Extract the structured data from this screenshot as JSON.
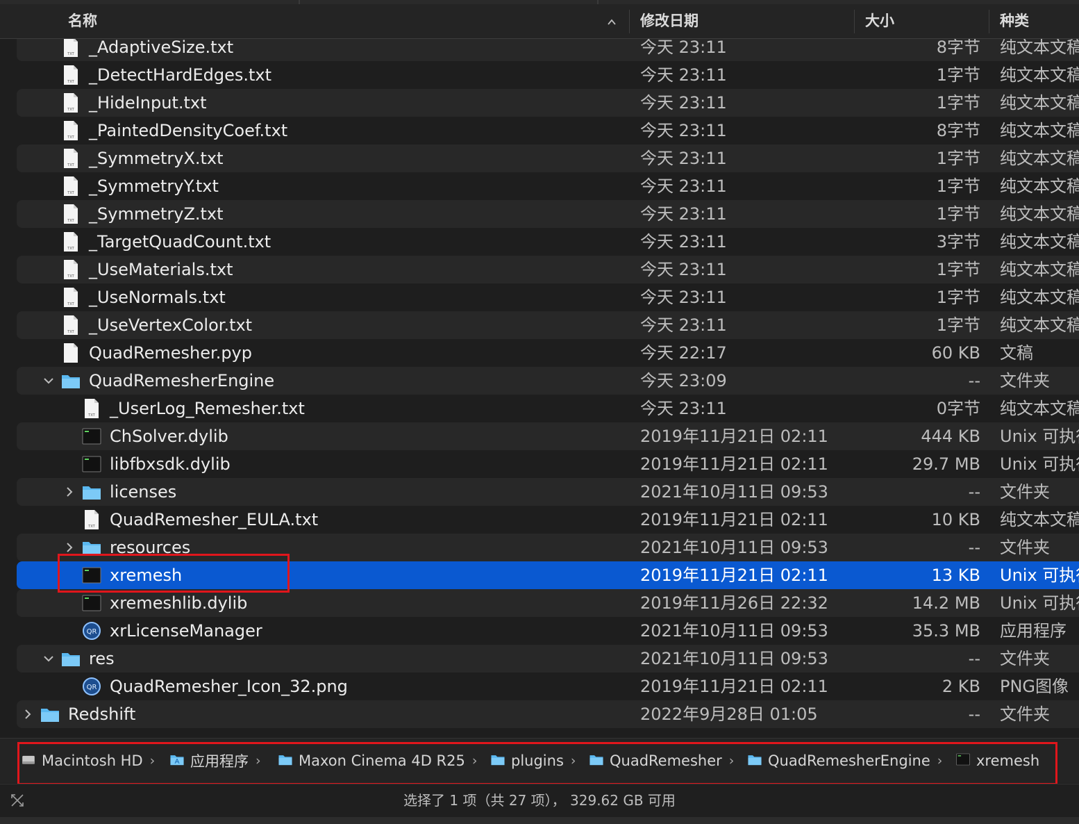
{
  "columns": {
    "name": "名称",
    "date": "修改日期",
    "size": "大小",
    "kind": "种类"
  },
  "rows": [
    {
      "name": "_AdaptiveSize.txt",
      "date": "今天 23:11",
      "size": "8字节",
      "kind": "纯文本文稿",
      "icon": "txt-file-icon",
      "depth": 2
    },
    {
      "name": "_DetectHardEdges.txt",
      "date": "今天 23:11",
      "size": "1字节",
      "kind": "纯文本文稿",
      "icon": "txt-file-icon",
      "depth": 2
    },
    {
      "name": "_HideInput.txt",
      "date": "今天 23:11",
      "size": "1字节",
      "kind": "纯文本文稿",
      "icon": "txt-file-icon",
      "depth": 2
    },
    {
      "name": "_PaintedDensityCoef.txt",
      "date": "今天 23:11",
      "size": "8字节",
      "kind": "纯文本文稿",
      "icon": "txt-file-icon",
      "depth": 2
    },
    {
      "name": "_SymmetryX.txt",
      "date": "今天 23:11",
      "size": "1字节",
      "kind": "纯文本文稿",
      "icon": "txt-file-icon",
      "depth": 2
    },
    {
      "name": "_SymmetryY.txt",
      "date": "今天 23:11",
      "size": "1字节",
      "kind": "纯文本文稿",
      "icon": "txt-file-icon",
      "depth": 2
    },
    {
      "name": "_SymmetryZ.txt",
      "date": "今天 23:11",
      "size": "1字节",
      "kind": "纯文本文稿",
      "icon": "txt-file-icon",
      "depth": 2
    },
    {
      "name": "_TargetQuadCount.txt",
      "date": "今天 23:11",
      "size": "3字节",
      "kind": "纯文本文稿",
      "icon": "txt-file-icon",
      "depth": 2
    },
    {
      "name": "_UseMaterials.txt",
      "date": "今天 23:11",
      "size": "1字节",
      "kind": "纯文本文稿",
      "icon": "txt-file-icon",
      "depth": 2
    },
    {
      "name": "_UseNormals.txt",
      "date": "今天 23:11",
      "size": "1字节",
      "kind": "纯文本文稿",
      "icon": "txt-file-icon",
      "depth": 2
    },
    {
      "name": "_UseVertexColor.txt",
      "date": "今天 23:11",
      "size": "1字节",
      "kind": "纯文本文稿",
      "icon": "txt-file-icon",
      "depth": 2
    },
    {
      "name": "QuadRemesher.pyp",
      "date": "今天 22:17",
      "size": "60 KB",
      "kind": "文稿",
      "icon": "document-icon",
      "depth": 2
    },
    {
      "name": "QuadRemesherEngine",
      "date": "今天 23:09",
      "size": "--",
      "kind": "文件夹",
      "icon": "folder-icon",
      "depth": 2,
      "disclosure": "open"
    },
    {
      "name": "_UserLog_Remesher.txt",
      "date": "今天 23:11",
      "size": "0字节",
      "kind": "纯文本文稿",
      "icon": "txt-file-icon",
      "depth": 3
    },
    {
      "name": "ChSolver.dylib",
      "date": "2019年11月21日 02:11",
      "size": "444 KB",
      "kind": "Unix 可执行文件",
      "icon": "terminal-exec-icon",
      "depth": 3
    },
    {
      "name": "libfbxsdk.dylib",
      "date": "2019年11月21日 02:11",
      "size": "29.7 MB",
      "kind": "Unix 可执行文件",
      "icon": "terminal-exec-icon",
      "depth": 3
    },
    {
      "name": "licenses",
      "date": "2021年10月11日 09:53",
      "size": "--",
      "kind": "文件夹",
      "icon": "folder-icon",
      "depth": 3,
      "disclosure": "closed"
    },
    {
      "name": "QuadRemesher_EULA.txt",
      "date": "2019年11月21日 02:11",
      "size": "10 KB",
      "kind": "纯文本文稿",
      "icon": "txt-file-icon",
      "depth": 3
    },
    {
      "name": "resources",
      "date": "2021年10月11日 09:53",
      "size": "--",
      "kind": "文件夹",
      "icon": "folder-icon",
      "depth": 3,
      "disclosure": "closed"
    },
    {
      "name": "xremesh",
      "date": "2019年11月21日 02:11",
      "size": "13 KB",
      "kind": "Unix 可执行文件",
      "icon": "terminal-exec-icon",
      "depth": 3,
      "selected": true
    },
    {
      "name": "xremeshlib.dylib",
      "date": "2019年11月26日 22:32",
      "size": "14.2 MB",
      "kind": "Unix 可执行文件",
      "icon": "terminal-exec-icon",
      "depth": 3
    },
    {
      "name": "xrLicenseManager",
      "date": "2021年10月11日 09:53",
      "size": "35.3 MB",
      "kind": "应用程序",
      "icon": "qr-app-icon",
      "depth": 3
    },
    {
      "name": "res",
      "date": "2021年10月11日 09:53",
      "size": "--",
      "kind": "文件夹",
      "icon": "folder-icon",
      "depth": 2,
      "disclosure": "open"
    },
    {
      "name": "QuadRemesher_Icon_32.png",
      "date": "2019年11月21日 02:11",
      "size": "2 KB",
      "kind": "PNG图像",
      "icon": "qr-image-icon",
      "depth": 3
    },
    {
      "name": "Redshift",
      "date": "2022年9月28日 01:05",
      "size": "--",
      "kind": "文件夹",
      "icon": "folder-icon",
      "depth": 1,
      "disclosure": "closed"
    }
  ],
  "pathbar": [
    {
      "label": "Macintosh HD",
      "icon": "hard-drive-icon"
    },
    {
      "label": "应用程序",
      "icon": "applications-folder-icon"
    },
    {
      "label": "Maxon Cinema 4D R25",
      "icon": "folder-icon"
    },
    {
      "label": "plugins",
      "icon": "folder-icon"
    },
    {
      "label": "QuadRemesher",
      "icon": "folder-icon"
    },
    {
      "label": "QuadRemesherEngine",
      "icon": "folder-icon"
    },
    {
      "label": "xremesh",
      "icon": "terminal-exec-icon"
    }
  ],
  "status": {
    "text": "选择了 1 项（共 27 项）， 329.62 GB 可用"
  },
  "colors": {
    "selection": "#0a59d1",
    "folder": "#5ab8f0",
    "annotation": "#e0161c"
  }
}
